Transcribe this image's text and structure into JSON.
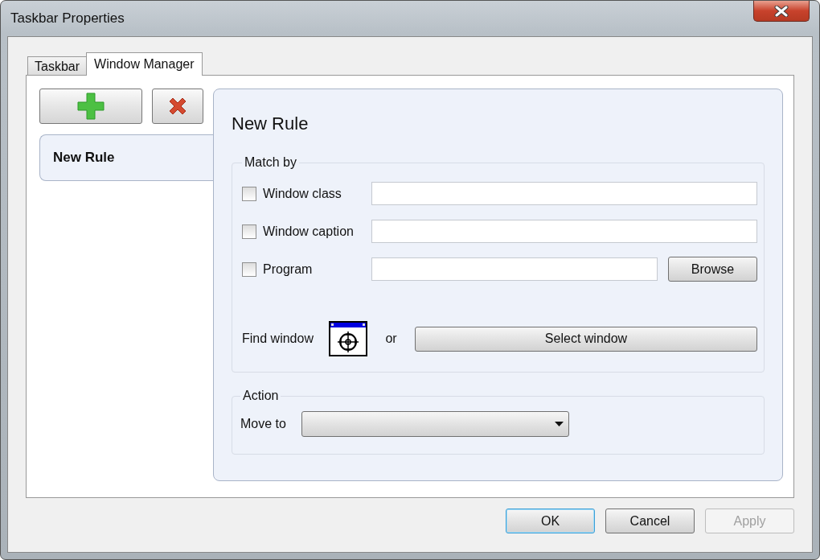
{
  "window": {
    "title": "Taskbar Properties"
  },
  "tabs": [
    {
      "label": "Taskbar",
      "selected": false
    },
    {
      "label": "Window Manager",
      "selected": true
    }
  ],
  "rules": [
    {
      "label": "New Rule",
      "selected": true
    }
  ],
  "rule_detail": {
    "title": "New Rule",
    "match_by": {
      "label": "Match by",
      "rows": [
        {
          "kind": "text",
          "label": "Window class",
          "checked": false
        },
        {
          "kind": "text",
          "label": "Window caption",
          "checked": false
        },
        {
          "kind": "browse",
          "label": "Program",
          "checked": false,
          "button": "Browse"
        }
      ],
      "find_window": {
        "label": "Find window",
        "or": "or",
        "button": "Select window"
      }
    },
    "action": {
      "label": "Action",
      "move_to": "Move to"
    }
  },
  "buttons": [
    {
      "label": "OK",
      "focused": true,
      "disabled": false
    },
    {
      "label": "Cancel",
      "focused": false,
      "disabled": false
    },
    {
      "label": "Apply",
      "focused": false,
      "disabled": true
    }
  ]
}
